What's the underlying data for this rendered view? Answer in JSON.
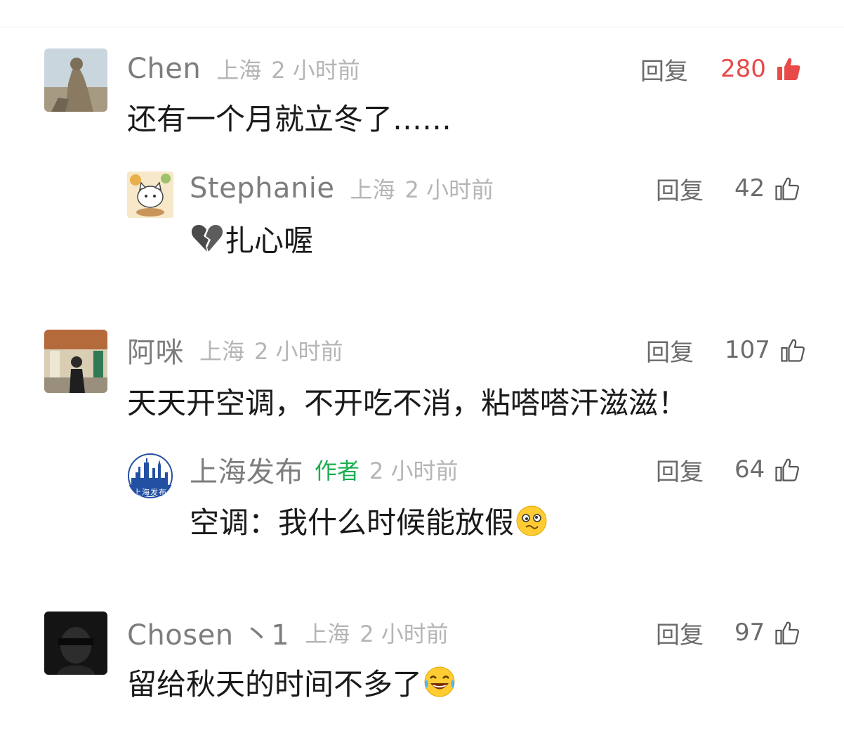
{
  "comments": [
    {
      "username": "Chen",
      "location": "上海",
      "time": "2 小时前",
      "reply_label": "回复",
      "likes": "280",
      "liked": true,
      "text": "还有一个月就立冬了……",
      "avatar_icon": "statue-photo-icon",
      "replies": [
        {
          "username": "Stephanie",
          "location": "上海",
          "time": "2 小时前",
          "reply_label": "回复",
          "likes": "42",
          "text": "扎心喔",
          "emoji": "broken-heart-icon",
          "avatar_icon": "cartoon-cat-icon"
        }
      ]
    },
    {
      "username": "阿咪",
      "location": "上海",
      "time": "2 小时前",
      "reply_label": "回复",
      "likes": "107",
      "text": "天天开空调，不开吃不消，粘嗒嗒汗滋滋！",
      "avatar_icon": "person-photo-icon",
      "replies": [
        {
          "username": "上海发布",
          "author_tag": "作者",
          "time": "2 小时前",
          "reply_label": "回复",
          "likes": "64",
          "text": "空调：我什么时候能放假",
          "emoji": "woozy-face-icon",
          "avatar_icon": "shanghai-skyline-logo-icon",
          "avatar_text": "上海发布"
        }
      ]
    },
    {
      "username": "Chosen 丶1",
      "location": "上海",
      "time": "2 小时前",
      "reply_label": "回复",
      "likes": "97",
      "text": "留给秋天的时间不多了",
      "emoji": "laughing-tears-icon",
      "avatar_icon": "dark-portrait-icon"
    }
  ],
  "colors": {
    "like_hot": "#e84a4a",
    "author_tag": "#1aad4f",
    "meta_gray": "#b5b5b5",
    "name_gray": "#7d7d7d"
  }
}
